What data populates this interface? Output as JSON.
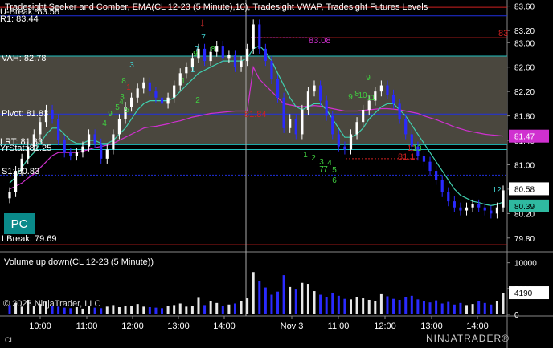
{
  "window": {
    "price_title": "Tradesight Seeker and Comber, EMA(CL 12-23 (5 Minute),10), Tradesight VWAP, Tradesight Futures Levels",
    "volume_title": "Volume up down(CL 12-23 (5 Minute))",
    "copyright": "© 2023 NinjaTrader, LLC",
    "footer_label": "CL",
    "brand": "NINJATRADER®",
    "pc_button": "PC"
  },
  "levels": {
    "unknown_top": "U-Break: 83.58",
    "r1": "R1: 83.44",
    "vah": "VAH: 82.78",
    "pivot": "Pivot: 81.83",
    "lrt": "LRT: 81.33",
    "yrstat": "YrStat: 81.25",
    "s1": "S1: 80.83",
    "lbreak": "LBreak: 79.69"
  },
  "annotations": {
    "vwap_label": "83.08",
    "pivot_inline": "81.84",
    "red_right": "83",
    "red_low": "81.1",
    "seeker_digits": [
      "13",
      "12",
      "11",
      "9",
      "10",
      "8",
      "9",
      "7",
      "7",
      "6",
      "5",
      "4",
      "3",
      "2",
      "1",
      "8",
      "1",
      "2",
      "3",
      "4",
      "5",
      "6",
      "9",
      "4",
      "5",
      "6",
      "8",
      "9",
      "1",
      "2",
      "3",
      "1"
    ]
  },
  "colors": {
    "background": "#000000",
    "up_candle": "#ffffff",
    "down_candle": "#2a2aff",
    "ema": "#40d0b0",
    "vwap": "#d030d0",
    "value_area": "#4a473e",
    "level_blue": "#2030e0",
    "level_cyan": "#20c0c0",
    "level_red": "#d02020",
    "current_price_box": "#d030d0",
    "last_price_box": "#ffffff"
  },
  "chart_data": [
    {
      "type": "candlestick",
      "title": "Tradesight Seeker and Comber, EMA(CL 12-23 (5 Minute),10), Tradesight VWAP, Tradesight Futures Levels",
      "x_tick_labels": [
        "10:00",
        "11:00",
        "12:00",
        "13:00",
        "14:00",
        "Nov 3",
        "11:00",
        "12:00",
        "13:00",
        "14:00"
      ],
      "y_tick_labels": [
        "83.60",
        "83.20",
        "83.00",
        "82.60",
        "82.20",
        "81.80",
        "81.40",
        "81.00",
        "80.60",
        "80.20",
        "79.80"
      ],
      "ylim": [
        79.6,
        83.7
      ],
      "price_labels": {
        "vwap_current": "81.47",
        "ema_current": "80.39",
        "last_price": "80.58"
      },
      "candles_close": [
        80.55,
        80.9,
        81.1,
        81.3,
        81.5,
        81.7,
        81.9,
        81.75,
        81.4,
        81.2,
        81.15,
        81.2,
        81.3,
        81.5,
        81.35,
        81.1,
        81.25,
        81.5,
        81.75,
        81.95,
        82.1,
        82.25,
        82.35,
        82.2,
        82.1,
        82.0,
        82.1,
        82.3,
        82.5,
        82.6,
        82.75,
        82.9,
        82.7,
        82.85,
        82.95,
        82.75,
        82.8,
        82.6,
        82.7,
        82.9,
        83.3,
        82.9,
        82.7,
        82.4,
        82.1,
        81.6,
        81.75,
        81.5,
        81.9,
        82.2,
        82.3,
        82.05,
        81.8,
        81.5,
        81.3,
        81.25,
        81.5,
        81.7,
        81.9,
        82.05,
        82.2,
        82.3,
        82.15,
        82.0,
        81.75,
        81.5,
        81.3,
        81.15,
        81.05,
        80.9,
        80.75,
        80.55,
        80.4,
        80.3,
        80.25,
        80.3,
        80.35,
        80.3,
        80.25,
        80.2,
        80.3,
        80.58
      ],
      "ema": [
        80.7,
        80.8,
        80.95,
        81.1,
        81.2,
        81.35,
        81.5,
        81.6,
        81.6,
        81.5,
        81.4,
        81.35,
        81.35,
        81.4,
        81.4,
        81.35,
        81.35,
        81.4,
        81.5,
        81.6,
        81.75,
        81.9,
        82.0,
        82.05,
        82.05,
        82.05,
        82.05,
        82.1,
        82.2,
        82.3,
        82.4,
        82.5,
        82.55,
        82.6,
        82.65,
        82.7,
        82.7,
        82.7,
        82.7,
        82.75,
        82.9,
        82.95,
        82.85,
        82.7,
        82.5,
        82.3,
        82.1,
        81.95,
        81.9,
        81.95,
        82.0,
        82.0,
        81.9,
        81.75,
        81.6,
        81.45,
        81.45,
        81.5,
        81.6,
        81.75,
        81.85,
        81.95,
        82.0,
        82.0,
        81.9,
        81.8,
        81.65,
        81.5,
        81.35,
        81.2,
        81.05,
        80.9,
        80.75,
        80.6,
        80.5,
        80.45,
        80.4,
        80.38,
        80.35,
        80.33,
        80.35,
        80.39
      ],
      "vwap": [
        80.6,
        80.65,
        80.7,
        80.78,
        80.85,
        80.95,
        81.05,
        81.15,
        81.2,
        81.2,
        81.2,
        81.2,
        81.22,
        81.25,
        81.28,
        81.3,
        81.32,
        81.35,
        81.4,
        81.45,
        81.5,
        81.55,
        81.6,
        81.62,
        81.63,
        81.65,
        81.67,
        81.7,
        81.72,
        81.75,
        81.78,
        81.8,
        81.82,
        81.84,
        81.85,
        81.86,
        81.87,
        81.88,
        81.88,
        81.88,
        82.6,
        82.4,
        82.3,
        82.2,
        82.1,
        82.0,
        81.98,
        81.96,
        81.95,
        81.96,
        81.97,
        81.96,
        81.94,
        81.92,
        81.9,
        81.88,
        81.88,
        81.88,
        81.89,
        81.9,
        81.91,
        81.92,
        81.92,
        81.91,
        81.9,
        81.88,
        81.86,
        81.84,
        81.8,
        81.77,
        81.74,
        81.7,
        81.66,
        81.62,
        81.59,
        81.56,
        81.54,
        81.52,
        81.5,
        81.49,
        81.48,
        81.47
      ]
    },
    {
      "type": "bar",
      "title": "Volume up down(CL 12-23 (5 Minute))",
      "y_tick_labels": [
        "10000",
        "5000",
        "0"
      ],
      "ylim": [
        0,
        11500
      ],
      "current_volume_label": "4190",
      "values": [
        1800,
        2200,
        1500,
        2800,
        1600,
        2000,
        2400,
        1700,
        1500,
        1300,
        1200,
        1400,
        1100,
        1600,
        1300,
        1200,
        1500,
        1800,
        1400,
        1700,
        1600,
        2000,
        1500,
        1400,
        1300,
        1200,
        1600,
        1800,
        2100,
        1500,
        1700,
        3200,
        1800,
        2500,
        2200,
        1600,
        1900,
        2100,
        2600,
        3100,
        8200,
        6500,
        5200,
        3800,
        4400,
        7600,
        5300,
        4800,
        6100,
        5900,
        4500,
        3800,
        3300,
        4200,
        3600,
        3000,
        2900,
        3400,
        3100,
        2800,
        2600,
        3900,
        3500,
        3000,
        2800,
        3300,
        3600,
        2900,
        2500,
        2300,
        2700,
        2100,
        2400,
        1900,
        2200,
        1800,
        2000,
        2500,
        2200,
        1900,
        2600,
        4190
      ],
      "directions": [
        "d",
        "u",
        "u",
        "u",
        "u",
        "u",
        "u",
        "d",
        "d",
        "d",
        "d",
        "u",
        "u",
        "u",
        "d",
        "d",
        "u",
        "u",
        "u",
        "u",
        "u",
        "u",
        "u",
        "d",
        "d",
        "d",
        "u",
        "u",
        "u",
        "u",
        "u",
        "u",
        "d",
        "u",
        "u",
        "d",
        "u",
        "d",
        "u",
        "u",
        "u",
        "d",
        "d",
        "d",
        "d",
        "d",
        "u",
        "d",
        "u",
        "u",
        "u",
        "d",
        "d",
        "d",
        "d",
        "d",
        "u",
        "u",
        "u",
        "u",
        "u",
        "u",
        "d",
        "d",
        "d",
        "d",
        "d",
        "d",
        "d",
        "d",
        "d",
        "d",
        "d",
        "d",
        "d",
        "u",
        "u",
        "d",
        "d",
        "d",
        "u",
        "u"
      ]
    }
  ]
}
